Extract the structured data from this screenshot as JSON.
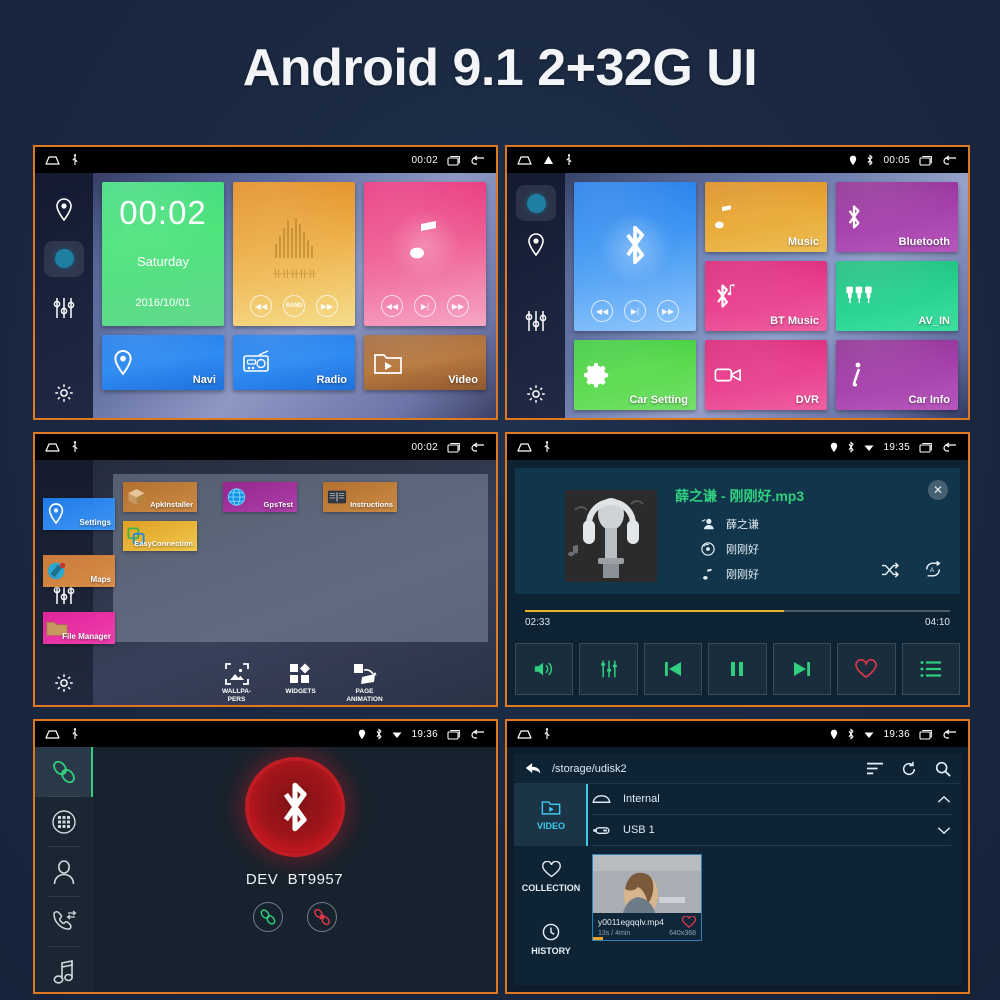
{
  "page": {
    "title": "Android 9.1 2+32G UI",
    "accent_border": "#e07820",
    "background": "#1b2a42"
  },
  "panels": {
    "home_launcher": {
      "statusbar": {
        "time": "00:02",
        "icons": [
          "home-icon",
          "usb-icon",
          "recents-icon",
          "back-icon"
        ]
      },
      "dock": [
        "location-icon",
        "circle-active-icon",
        "equalizer-icon",
        "gear-icon"
      ],
      "clock_widget": {
        "time": "00:02",
        "day": "Saturday",
        "date": "2016/10/01"
      },
      "radio_widget": {
        "prev": "prev-icon",
        "band": "BAND",
        "next": "next-icon"
      },
      "music_widget": {
        "prev": "prev-icon",
        "play": "play-pause-icon",
        "next": "next-icon"
      },
      "shortcuts": [
        {
          "label": "Navi",
          "icon": "location-pin-icon"
        },
        {
          "label": "Radio",
          "icon": "radio-icon"
        },
        {
          "label": "Video",
          "icon": "video-folder-icon"
        }
      ]
    },
    "app_grid": {
      "statusbar": {
        "time": "00:05",
        "icons": [
          "home-icon",
          "warning-icon",
          "usb-icon",
          "location-icon",
          "bluetooth-icon",
          "recents-icon",
          "back-icon"
        ]
      },
      "dock": [
        "circle-active-icon",
        "location-icon",
        "equalizer-icon",
        "gear-icon"
      ],
      "bt_widget": {
        "icon": "bluetooth-icon",
        "prev": "prev-icon",
        "play": "play-pause-icon",
        "next": "next-icon"
      },
      "tiles": [
        {
          "label": "Music",
          "icon": "music-note-icon"
        },
        {
          "label": "Bluetooth",
          "icon": "bluetooth-icon"
        },
        {
          "label": "BT Music",
          "icon": "bt-music-icon"
        },
        {
          "label": "AV_IN",
          "icon": "av-plug-icon"
        },
        {
          "label": "Car Setting",
          "icon": "gear-icon"
        },
        {
          "label": "DVR",
          "icon": "camcorder-icon"
        },
        {
          "label": "Car Info",
          "icon": "info-icon"
        }
      ]
    },
    "app_drawer": {
      "statusbar": {
        "time": "00:02",
        "icons": [
          "home-icon",
          "usb-icon",
          "recents-icon",
          "back-icon"
        ]
      },
      "dock": [
        "location-icon",
        "equalizer-icon",
        "gear-icon"
      ],
      "side_apps": [
        {
          "label": "Settings",
          "icon": "location-pin-icon"
        },
        {
          "label": "Maps",
          "icon": "maps-icon"
        },
        {
          "label": "File Manager",
          "icon": "folder-icon"
        }
      ],
      "apps": [
        {
          "label": "ApkInstaller",
          "icon": "package-icon"
        },
        {
          "label": "GpsTest",
          "icon": "globe-icon"
        },
        {
          "label": "Instructions",
          "icon": "book-icon"
        },
        {
          "label": "EasyConnection",
          "icon": "link-square-icon"
        }
      ],
      "bottom_bar": [
        {
          "label": "WALLPA-PERS",
          "icon": "wallpaper-icon"
        },
        {
          "label": "WIDGETS",
          "icon": "widgets-icon"
        },
        {
          "label": "PAGE ANIMATION",
          "icon": "page-animation-icon"
        }
      ]
    },
    "music_player": {
      "statusbar": {
        "time": "19:35",
        "icons": [
          "home-icon",
          "usb-icon",
          "location-icon",
          "bluetooth-icon",
          "wifi-icon",
          "recents-icon",
          "back-icon"
        ]
      },
      "track_title": "薛之谦 - 刚刚好.mp3",
      "artist": "薛之谦",
      "album": "刚刚好",
      "song": "刚刚好",
      "meta_icons": [
        "artist-icon",
        "album-icon",
        "song-icon"
      ],
      "elapsed": "02:33",
      "duration": "04:10",
      "progress_percent": 61,
      "shuffle_icon": "shuffle-icon",
      "repeat_icon": "repeat-all-icon",
      "close_icon": "close-icon",
      "transport": [
        "volume-icon",
        "equalizer-icon",
        "previous-icon",
        "pause-icon",
        "next-icon",
        "favorite-icon",
        "playlist-icon"
      ],
      "accent": "#2fcf7f",
      "progress_color": "#e8b32a"
    },
    "bluetooth": {
      "statusbar": {
        "time": "19:36",
        "icons": [
          "home-icon",
          "usb-icon",
          "location-icon",
          "bluetooth-icon",
          "wifi-icon",
          "recents-icon",
          "back-icon"
        ]
      },
      "sidebar": [
        "link-icon",
        "dialpad-icon",
        "contacts-icon",
        "call-log-icon",
        "bt-music-icon"
      ],
      "device_prefix": "DEV",
      "device_name": "BT9957",
      "actions": [
        "connect-icon",
        "disconnect-icon"
      ],
      "orb_color": "#c2171c"
    },
    "file_manager": {
      "statusbar": {
        "time": "19:36",
        "icons": [
          "home-icon",
          "usb-icon",
          "location-icon",
          "bluetooth-icon",
          "wifi-icon",
          "recents-icon",
          "back-icon"
        ]
      },
      "path": "/storage/udisk2",
      "top_actions": [
        "sort-icon",
        "refresh-icon",
        "search-icon"
      ],
      "tabs": [
        {
          "label": "VIDEO",
          "icon": "video-folder-icon",
          "active": true
        },
        {
          "label": "COLLECTION",
          "icon": "heart-icon",
          "active": false
        },
        {
          "label": "HISTORY",
          "icon": "clock-icon",
          "active": false
        }
      ],
      "drives": [
        {
          "label": "Internal",
          "icon": "internal-drive-icon",
          "chevron": "chevron-up-icon"
        },
        {
          "label": "USB 1",
          "icon": "usb-drive-icon",
          "chevron": "chevron-down-icon"
        }
      ],
      "files": [
        {
          "name": "y0011egqqlv.mp4",
          "duration": "13s / 4min",
          "resolution": "640x368",
          "favorite_icon": "heart-icon"
        }
      ]
    }
  }
}
